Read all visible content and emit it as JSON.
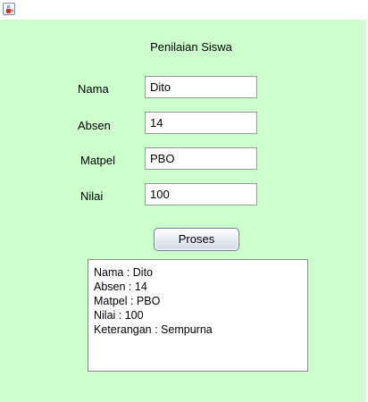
{
  "window": {
    "icon": "java-cup-icon"
  },
  "form": {
    "title": "Penilaian Siswa",
    "fields": [
      {
        "label": "Nama",
        "value": "Dito"
      },
      {
        "label": "Absen",
        "value": "14"
      },
      {
        "label": "Matpel",
        "value": "PBO"
      },
      {
        "label": "Nilai",
        "value": "100"
      }
    ],
    "button_label": "Proses"
  },
  "result": {
    "lines": [
      "Nama : Dito",
      "Absen : 14",
      "Matpel : PBO",
      "Nilai : 100",
      "Keterangan : Sempurna"
    ]
  },
  "colors": {
    "panel_background": "#ccffcc"
  }
}
